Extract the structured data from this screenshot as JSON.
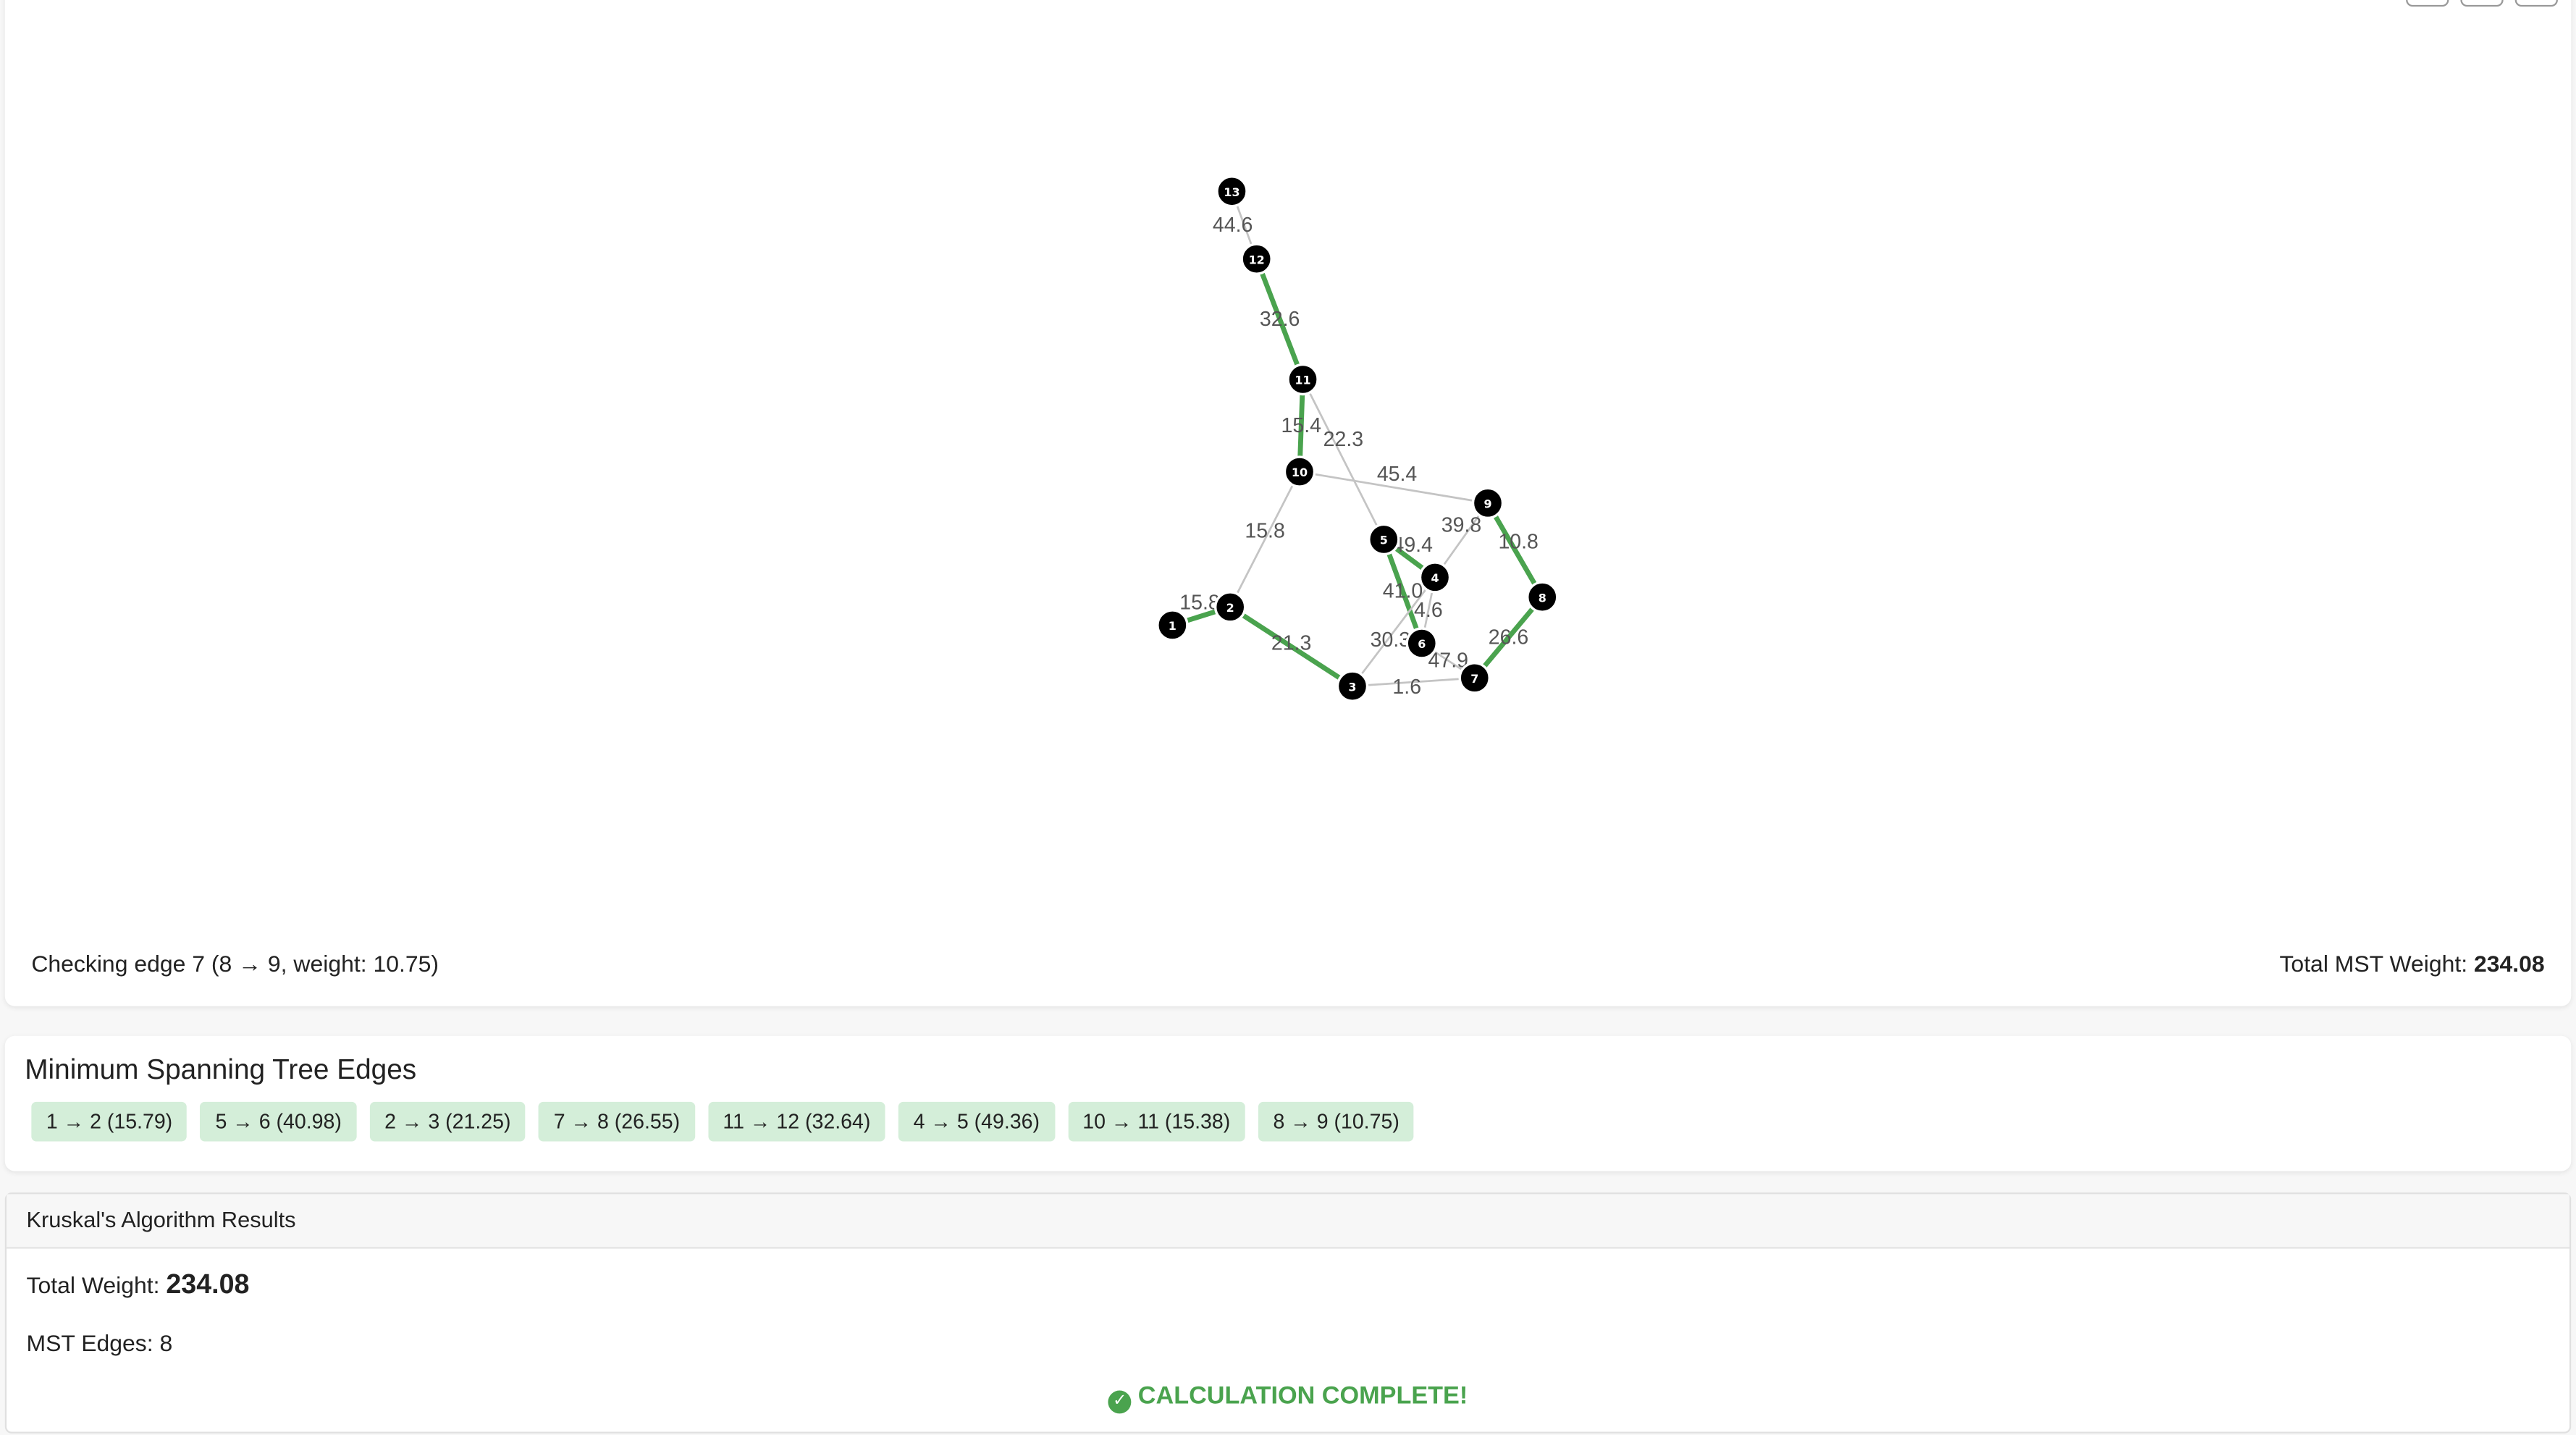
{
  "graph": {
    "nodes": [
      {
        "id": "1"
      },
      {
        "id": "2"
      },
      {
        "id": "3"
      },
      {
        "id": "4"
      },
      {
        "id": "5"
      },
      {
        "id": "6"
      },
      {
        "id": "7"
      },
      {
        "id": "8"
      },
      {
        "id": "9"
      },
      {
        "id": "10"
      },
      {
        "id": "11"
      },
      {
        "id": "12"
      },
      {
        "id": "13"
      }
    ],
    "edges": [
      {
        "from": "12",
        "to": "13",
        "label": "44.6",
        "mst": false
      },
      {
        "from": "11",
        "to": "12",
        "label": "32.6",
        "mst": true
      },
      {
        "from": "10",
        "to": "11",
        "label": "15.4",
        "mst": true
      },
      {
        "from": "11",
        "to": "5",
        "label": "22.3",
        "mst": false
      },
      {
        "from": "10",
        "to": "9",
        "label": "45.4",
        "mst": false
      },
      {
        "from": "10",
        "to": "2",
        "label": "15.8",
        "mst": false
      },
      {
        "from": "1",
        "to": "2",
        "label": "15.8",
        "mst": true
      },
      {
        "from": "2",
        "to": "3",
        "label": "21.3",
        "mst": true
      },
      {
        "from": "5",
        "to": "4",
        "label": "49.4",
        "mst": true
      },
      {
        "from": "4",
        "to": "9",
        "label": "39.8",
        "mst": false
      },
      {
        "from": "9",
        "to": "8",
        "label": "10.8",
        "mst": true
      },
      {
        "from": "5",
        "to": "6",
        "label": "41.0",
        "mst": true
      },
      {
        "from": "4",
        "to": "6",
        "label": "4.6",
        "mst": false
      },
      {
        "from": "3",
        "to": "4",
        "label": "30.3",
        "mst": false
      },
      {
        "from": "6",
        "to": "7",
        "label": "47.9",
        "mst": false
      },
      {
        "from": "8",
        "to": "7",
        "label": "26.6",
        "mst": true
      },
      {
        "from": "3",
        "to": "7",
        "label": "1.6",
        "mst": false
      }
    ]
  },
  "status": {
    "text": "Checking edge 7 (8 → 9, weight: 10.75)",
    "total_label": "Total MST Weight:",
    "total_value": "234.08"
  },
  "mst_panel": {
    "title": "Minimum Spanning Tree Edges",
    "chips": [
      "1 → 2 (15.79)",
      "5 → 6 (40.98)",
      "2 → 3 (21.25)",
      "7 → 8 (26.55)",
      "11 → 12 (32.64)",
      "4 → 5 (49.36)",
      "10 → 11 (15.38)",
      "8 → 9 (10.75)"
    ]
  },
  "results": {
    "header": "Kruskal's Algorithm Results",
    "weight_label": "Total Weight:",
    "weight_value": "234.08",
    "edges_line": "MST Edges: 8",
    "complete_text": "CALCULATION COMPLETE!"
  },
  "colors": {
    "mst_edge": "#4aa34e",
    "edge": "#c4c4c4",
    "node": "#000000",
    "success": "#4aa34e"
  }
}
